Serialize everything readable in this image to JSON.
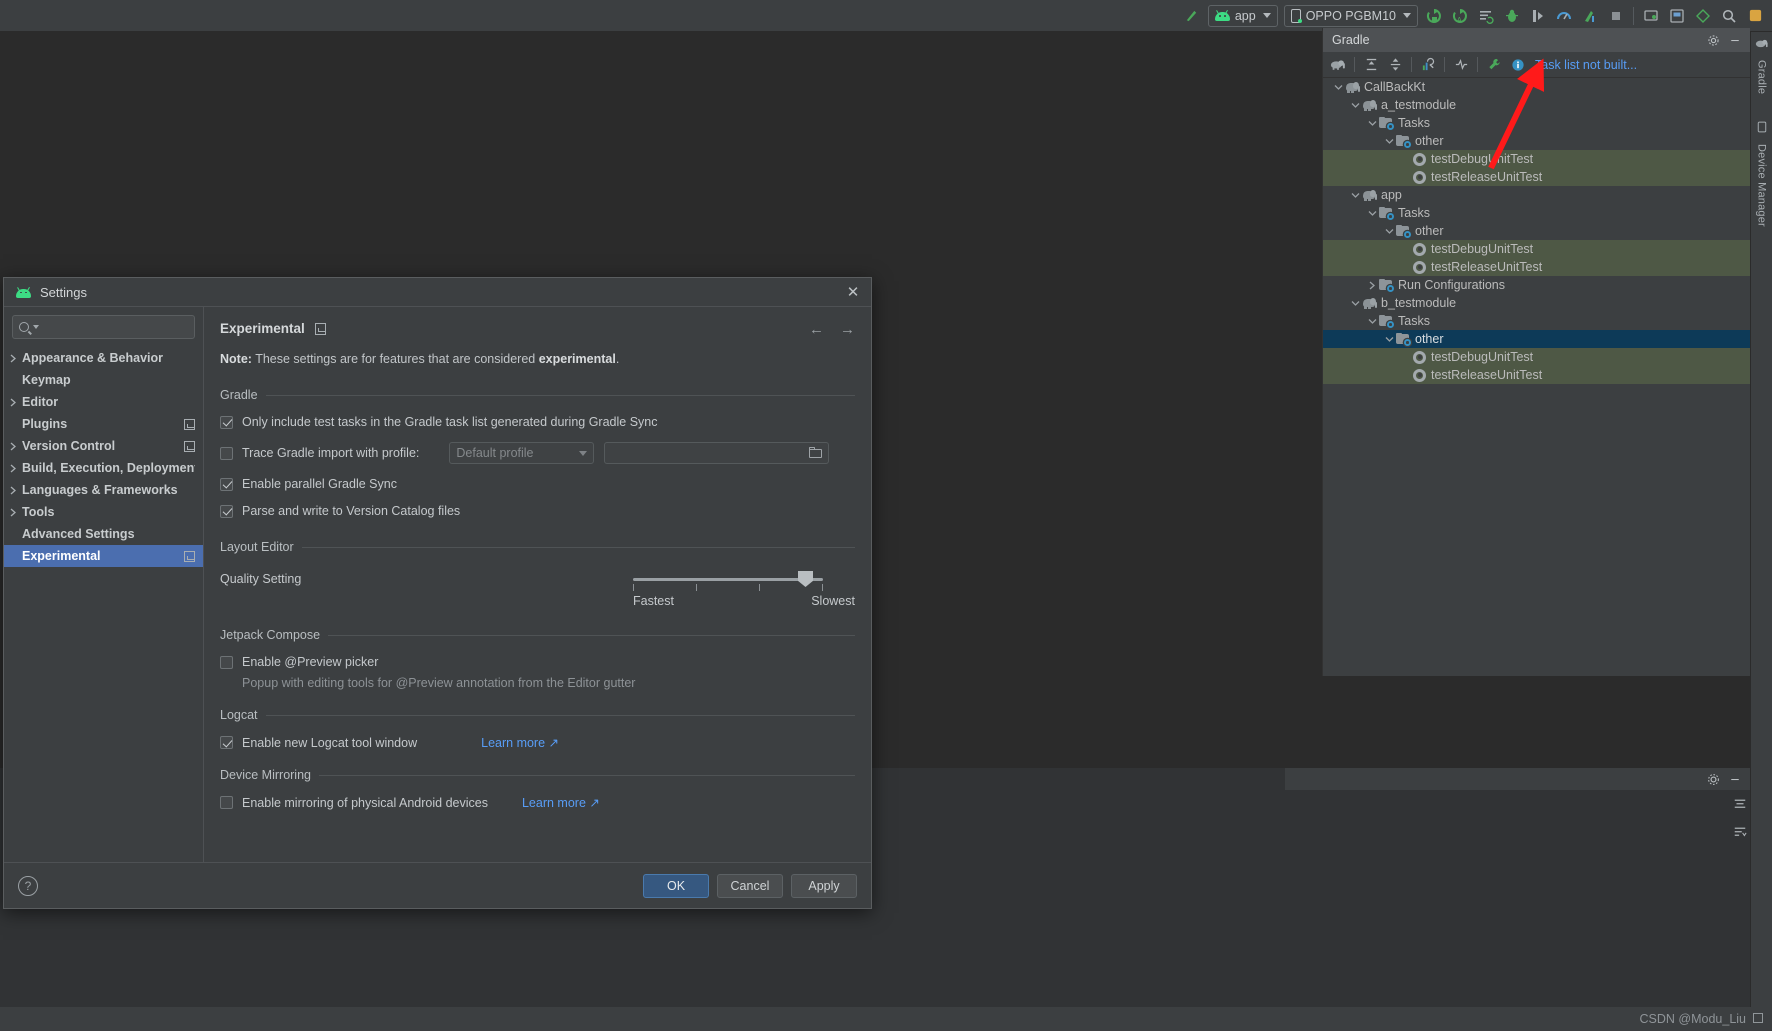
{
  "toolbar": {
    "icons": [
      {
        "name": "hammer-build-icon",
        "glyph": "⌁"
      },
      {
        "name": "run-step-icon",
        "glyph": "↻"
      },
      {
        "name": "rerun-tests-icon",
        "glyph": "↻"
      },
      {
        "name": "logcat-icon",
        "glyph": "≡"
      },
      {
        "name": "debug-bug-icon",
        "glyph": "🐞"
      },
      {
        "name": "attach-debugger-icon",
        "glyph": "▶"
      },
      {
        "name": "profiler-icon",
        "glyph": "◔"
      },
      {
        "name": "profile-app-icon",
        "glyph": "✦"
      },
      {
        "name": "stop-icon",
        "glyph": "■"
      },
      {
        "name": "device-manager-icon",
        "glyph": "▤"
      },
      {
        "name": "layout-inspector-icon",
        "glyph": "▣"
      },
      {
        "name": "sdk-manager-icon",
        "glyph": "◈"
      },
      {
        "name": "search-icon",
        "glyph": "⌕"
      },
      {
        "name": "settings-gear-icon",
        "glyph": "⚙"
      },
      {
        "name": "avd-icon",
        "glyph": "▦"
      }
    ],
    "build_variant_label": "app",
    "device_label": "OPPO PGBM10"
  },
  "right_strip": {
    "gradle_label": "Gradle",
    "device_manager_label": "Device Manager"
  },
  "gradle_panel": {
    "title": "Gradle",
    "toolbar": {
      "sync_label": "sync-gradle-icon",
      "expand_all_label": "expand-all-icon",
      "collapse_all_label": "collapse-all-icon",
      "execute_task_label": "execute-task-icon",
      "toggle_offline_label": "toggle-offline-icon",
      "build_tools_label": "build-tools-icon"
    },
    "warning_text": "Task list not built...",
    "tree": [
      {
        "label": "CallBackKt",
        "depth": 0,
        "icon": "gradle-project-icon",
        "twisty": "open",
        "highlight": "none"
      },
      {
        "label": "a_testmodule",
        "depth": 1,
        "icon": "gradle-module-icon",
        "twisty": "open",
        "highlight": "none"
      },
      {
        "label": "Tasks",
        "depth": 2,
        "icon": "task-folder-icon",
        "twisty": "open",
        "highlight": "none"
      },
      {
        "label": "other",
        "depth": 3,
        "icon": "task-folder-icon",
        "twisty": "open",
        "highlight": "none"
      },
      {
        "label": "testDebugUnitTest",
        "depth": 4,
        "icon": "gradle-task-icon",
        "twisty": "none",
        "highlight": "green"
      },
      {
        "label": "testReleaseUnitTest",
        "depth": 4,
        "icon": "gradle-task-icon",
        "twisty": "none",
        "highlight": "green"
      },
      {
        "label": "app",
        "depth": 1,
        "icon": "gradle-module-icon",
        "twisty": "open",
        "highlight": "none"
      },
      {
        "label": "Tasks",
        "depth": 2,
        "icon": "task-folder-icon",
        "twisty": "open",
        "highlight": "none"
      },
      {
        "label": "other",
        "depth": 3,
        "icon": "task-folder-icon",
        "twisty": "open",
        "highlight": "none"
      },
      {
        "label": "testDebugUnitTest",
        "depth": 4,
        "icon": "gradle-task-icon",
        "twisty": "none",
        "highlight": "green"
      },
      {
        "label": "testReleaseUnitTest",
        "depth": 4,
        "icon": "gradle-task-icon",
        "twisty": "none",
        "highlight": "green"
      },
      {
        "label": "Run Configurations",
        "depth": 2,
        "icon": "task-folder-icon",
        "twisty": "closed",
        "highlight": "none"
      },
      {
        "label": "b_testmodule",
        "depth": 1,
        "icon": "gradle-module-icon",
        "twisty": "open",
        "highlight": "none"
      },
      {
        "label": "Tasks",
        "depth": 2,
        "icon": "task-folder-icon",
        "twisty": "open",
        "highlight": "none"
      },
      {
        "label": "other",
        "depth": 3,
        "icon": "task-folder-icon",
        "twisty": "open",
        "highlight": "blue"
      },
      {
        "label": "testDebugUnitTest",
        "depth": 4,
        "icon": "gradle-task-icon",
        "twisty": "none",
        "highlight": "green"
      },
      {
        "label": "testReleaseUnitTest",
        "depth": 4,
        "icon": "gradle-task-icon",
        "twisty": "none",
        "highlight": "green"
      }
    ]
  },
  "settings_dialog": {
    "title": "Settings",
    "close_label": "✕",
    "search": {
      "value": "",
      "placeholder": ""
    },
    "nav": [
      {
        "label": "Appearance & Behavior",
        "arrow": true,
        "badge": false,
        "selected": false
      },
      {
        "label": "Keymap",
        "arrow": false,
        "badge": false,
        "selected": false
      },
      {
        "label": "Editor",
        "arrow": true,
        "badge": false,
        "selected": false
      },
      {
        "label": "Plugins",
        "arrow": false,
        "badge": true,
        "selected": false
      },
      {
        "label": "Version Control",
        "arrow": true,
        "badge": true,
        "selected": false
      },
      {
        "label": "Build, Execution, Deployment",
        "arrow": true,
        "badge": false,
        "selected": false
      },
      {
        "label": "Languages & Frameworks",
        "arrow": true,
        "badge": false,
        "selected": false
      },
      {
        "label": "Tools",
        "arrow": true,
        "badge": false,
        "selected": false
      },
      {
        "label": "Advanced Settings",
        "arrow": false,
        "badge": false,
        "selected": false
      },
      {
        "label": "Experimental",
        "arrow": false,
        "badge": true,
        "selected": true
      }
    ],
    "main": {
      "title": "Experimental",
      "back_arrow": "←",
      "forward_arrow": "→",
      "note_prefix": "Note:",
      "note_text": " These settings are for features that are considered ",
      "note_bold": "experimental",
      "note_suffix": ".",
      "sections": {
        "gradle": "Gradle",
        "layout_editor": "Layout Editor",
        "jetpack_compose": "Jetpack Compose",
        "logcat": "Logcat",
        "device_mirroring": "Device Mirroring"
      },
      "options": {
        "only_include_test_tasks": {
          "label": "Only include test tasks in the Gradle task list generated during Gradle Sync",
          "checked": true
        },
        "trace_gradle_import": {
          "label": "Trace Gradle import with profile:",
          "checked": false
        },
        "trace_profile_value": "Default profile",
        "trace_path_value": "",
        "enable_parallel_sync": {
          "label": "Enable parallel Gradle Sync",
          "checked": true
        },
        "parse_version_catalog": {
          "label": "Parse and write to Version Catalog files",
          "checked": true
        },
        "quality_setting_label": "Quality Setting",
        "quality_fastest": "Fastest",
        "quality_slowest": "Slowest",
        "enable_preview_picker": {
          "label": "Enable @Preview picker",
          "checked": false
        },
        "preview_picker_note": "Popup with editing tools for @Preview annotation from the Editor gutter",
        "enable_new_logcat": {
          "label": "Enable new Logcat tool window",
          "checked": true
        },
        "logcat_learn_more": "Learn more ↗",
        "enable_device_mirroring": {
          "label": "Enable mirroring of physical Android devices",
          "checked": false
        },
        "mirroring_learn_more": "Learn more ↗"
      }
    },
    "footer": {
      "help_label": "?",
      "ok_label": "OK",
      "cancel_label": "Cancel",
      "apply_label": "Apply"
    }
  },
  "status_bar": {
    "watermark": "CSDN @Modu_Liu"
  }
}
